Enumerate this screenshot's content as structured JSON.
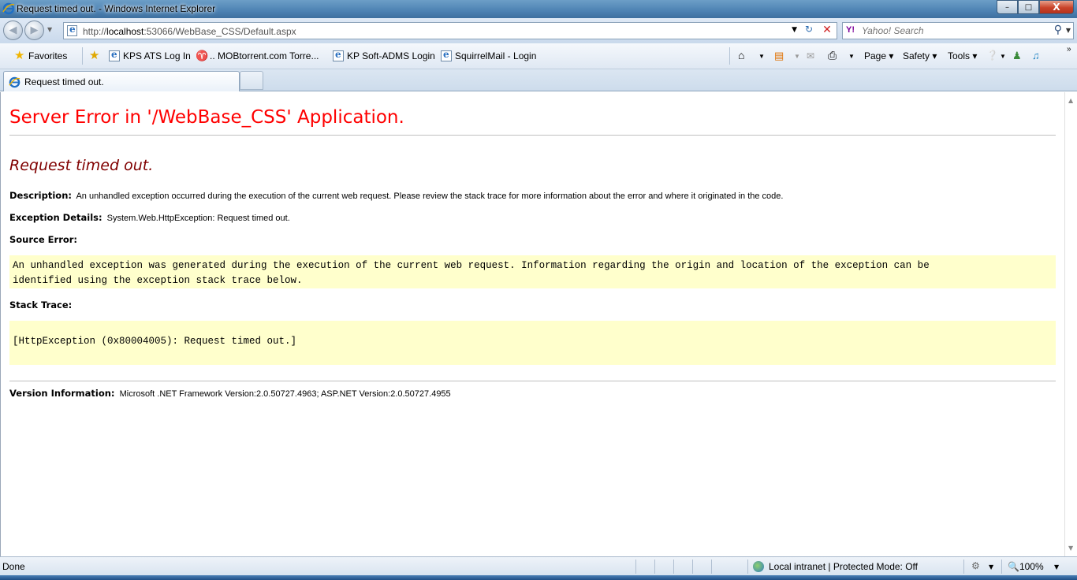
{
  "window": {
    "title": "Request timed out. - Windows Internet Explorer",
    "min": "–",
    "max": "□",
    "close": "X"
  },
  "address": {
    "url_prefix": "http://",
    "url_host": "localhost",
    "url_rest": ":53066/WebBase_CSS/Default.aspx"
  },
  "search": {
    "placeholder": "Yahoo! Search",
    "engine_icon": "Y!"
  },
  "favorites": {
    "label": "Favorites",
    "items": [
      "KPS ATS Log In",
      ".. MOBtorrent.com  Torre...",
      "KP Soft-ADMS Login",
      "SquirrelMail - Login"
    ]
  },
  "commandbar": {
    "page": "Page ▾",
    "safety": "Safety ▾",
    "tools": "Tools ▾"
  },
  "tab": {
    "label": "Request timed out."
  },
  "error_page": {
    "heading": "Server Error in '/WebBase_CSS' Application.",
    "subheading": "Request timed out.",
    "description_label": "Description:",
    "description_text": "An unhandled exception occurred during the execution of the current web request. Please review the stack trace for more information about the error and where it originated in the code.",
    "exception_label": "Exception Details:",
    "exception_text": "System.Web.HttpException: Request timed out.",
    "source_error_label": "Source Error:",
    "source_error_line1": "An unhandled exception was generated during the execution of the current web request. Information regarding the origin and location of the exception can be",
    "source_error_line2": "identified using the exception stack trace below.",
    "stack_trace_label": "Stack Trace:",
    "stack_trace_text": "[HttpException (0x80004005): Request timed out.]",
    "version_label": "Version Information:",
    "version_text": "Microsoft .NET Framework Version:2.0.50727.4963; ASP.NET Version:2.0.50727.4955"
  },
  "statusbar": {
    "status": "Done",
    "zone": "Local intranet | Protected Mode: Off",
    "zoom": "100%"
  },
  "colors": {
    "heading": "#ff0000",
    "subheading": "#800000",
    "codebox": "#ffffcc"
  }
}
